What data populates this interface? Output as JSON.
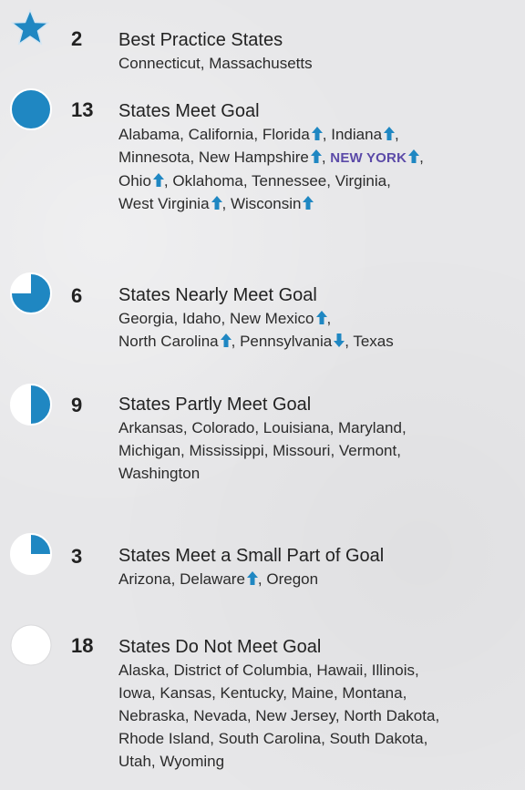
{
  "colors": {
    "accent": "#1f87c2",
    "highlight": "#5b4aa8",
    "text": "#2b2b2b"
  },
  "groups": [
    {
      "icon": "star-icon",
      "fill": 1,
      "count": "2",
      "title": "Best Practice States",
      "states": [
        {
          "name": "Connecticut"
        },
        {
          "name": "Massachusetts"
        }
      ]
    },
    {
      "icon": "full-circle-icon",
      "fill": 1,
      "count": "13",
      "title": "States Meet Goal",
      "states": [
        {
          "name": "Alabama"
        },
        {
          "name": "California"
        },
        {
          "name": "Florida",
          "trend": "up"
        },
        {
          "name": "Indiana",
          "trend": "up"
        },
        {
          "name": "Minnesota"
        },
        {
          "name": "New Hampshire",
          "trend": "up"
        },
        {
          "name": "NEW YORK",
          "trend": "up",
          "highlight": true
        },
        {
          "name": "Ohio",
          "trend": "up"
        },
        {
          "name": "Oklahoma"
        },
        {
          "name": "Tennessee"
        },
        {
          "name": "Virginia"
        },
        {
          "name": "West Virginia",
          "trend": "up"
        },
        {
          "name": "Wisconsin",
          "trend": "up"
        }
      ]
    },
    {
      "icon": "three-quarter-circle-icon",
      "fill": 0.75,
      "count": "6",
      "title": "States Nearly Meet Goal",
      "states": [
        {
          "name": "Georgia"
        },
        {
          "name": "Idaho"
        },
        {
          "name": "New Mexico",
          "trend": "up"
        },
        {
          "name": "North Carolina",
          "trend": "up"
        },
        {
          "name": "Pennsylvania",
          "trend": "down"
        },
        {
          "name": "Texas"
        }
      ]
    },
    {
      "icon": "half-circle-icon",
      "fill": 0.5,
      "count": "9",
      "title": "States Partly Meet Goal",
      "states": [
        {
          "name": "Arkansas"
        },
        {
          "name": "Colorado"
        },
        {
          "name": "Louisiana"
        },
        {
          "name": "Maryland"
        },
        {
          "name": "Michigan"
        },
        {
          "name": "Mississippi"
        },
        {
          "name": "Missouri"
        },
        {
          "name": "Vermont"
        },
        {
          "name": "Washington"
        }
      ]
    },
    {
      "icon": "quarter-circle-icon",
      "fill": 0.25,
      "count": "3",
      "title": "States Meet a Small Part of Goal",
      "states": [
        {
          "name": "Arizona"
        },
        {
          "name": "Delaware",
          "trend": "up"
        },
        {
          "name": "Oregon"
        }
      ]
    },
    {
      "icon": "empty-circle-icon",
      "fill": 0,
      "count": "18",
      "title": "States Do Not Meet Goal",
      "states": [
        {
          "name": "Alaska"
        },
        {
          "name": "District of Columbia"
        },
        {
          "name": "Hawaii"
        },
        {
          "name": "Illinois"
        },
        {
          "name": "Iowa"
        },
        {
          "name": "Kansas"
        },
        {
          "name": "Kentucky"
        },
        {
          "name": "Maine"
        },
        {
          "name": "Montana"
        },
        {
          "name": "Nebraska"
        },
        {
          "name": "Nevada"
        },
        {
          "name": "New Jersey"
        },
        {
          "name": "North Dakota"
        },
        {
          "name": "Rhode Island"
        },
        {
          "name": "South Carolina"
        },
        {
          "name": "South Dakota"
        },
        {
          "name": "Utah"
        },
        {
          "name": "Wyoming"
        }
      ]
    }
  ]
}
